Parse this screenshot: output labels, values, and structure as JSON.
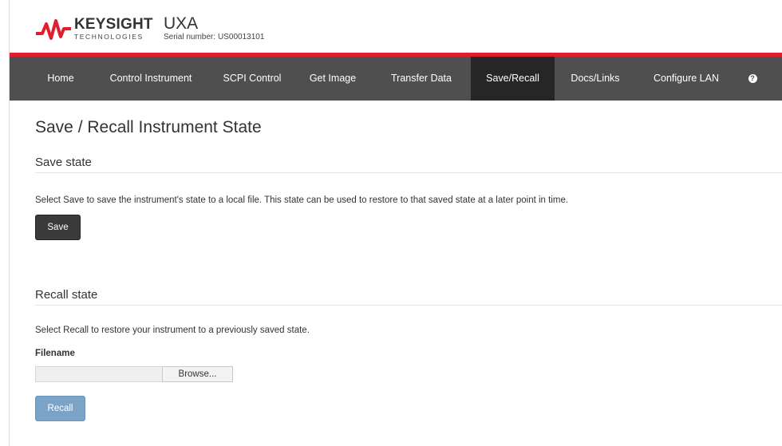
{
  "header": {
    "brand_name": "KEYSIGHT",
    "brand_sub": "TECHNOLOGIES",
    "product_name": "UXA",
    "serial_label": "Serial number:",
    "serial_value": "US00013101",
    "logo_icon": "keysight-wave-logo",
    "accent_color": "#e01e2d"
  },
  "nav": {
    "items": [
      {
        "label": "Home"
      },
      {
        "label": "Control Instrument"
      },
      {
        "label": "SCPI Control"
      },
      {
        "label": "Get Image"
      },
      {
        "label": "Transfer Data"
      },
      {
        "label": "Save/Recall",
        "active": true
      },
      {
        "label": "Docs/Links"
      },
      {
        "label": "Configure LAN"
      }
    ],
    "help_icon": "help-circle-icon",
    "help_glyph": "?"
  },
  "main": {
    "title": "Save / Recall Instrument State",
    "save_section": {
      "title": "Save state",
      "description": "Select Save to save the instrument's state to a local file. This state can be used to restore to that saved state at a later point in time.",
      "button_label": "Save"
    },
    "recall_section": {
      "title": "Recall state",
      "description": "Select Recall to restore your instrument to a previously saved state.",
      "filename_label": "Filename",
      "file_value": "",
      "browse_label": "Browse...",
      "button_label": "Recall"
    }
  }
}
